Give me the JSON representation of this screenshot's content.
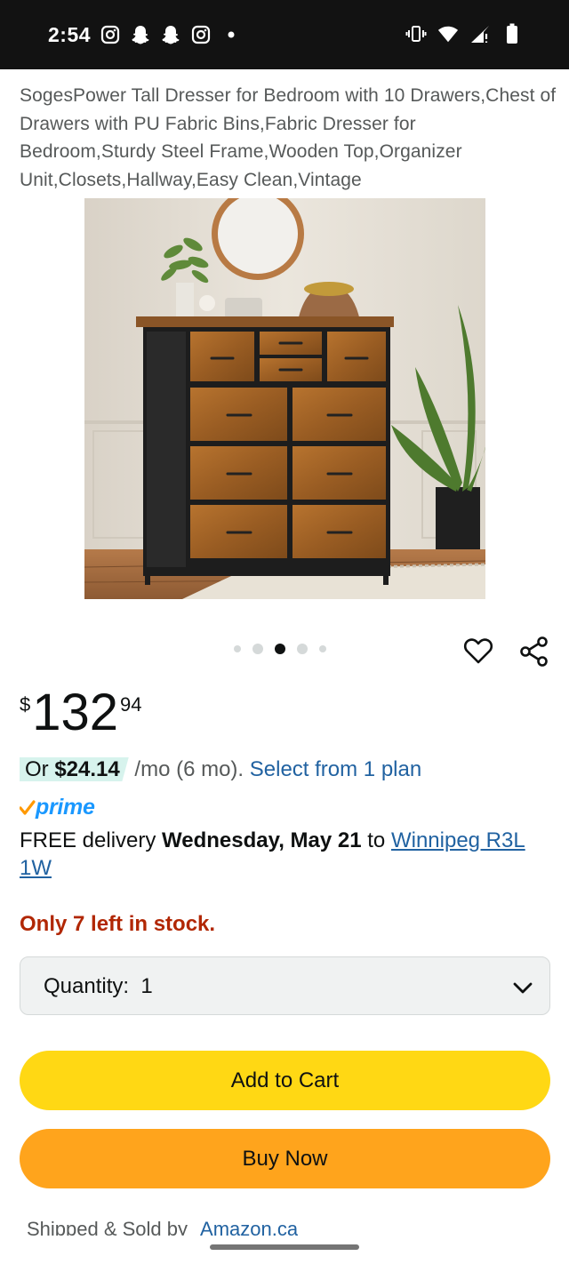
{
  "status_bar": {
    "time": "2:54",
    "left_icons": [
      "instagram-icon",
      "snapchat-icon",
      "snapchat-icon",
      "instagram-icon",
      "dot-icon"
    ],
    "right_icons": [
      "vibrate-icon",
      "wifi-icon",
      "signal-icon",
      "battery-icon"
    ]
  },
  "product": {
    "title": "SogesPower Tall Dresser for Bedroom with 10 Drawers,Chest of Drawers with PU Fabric Bins,Fabric Dresser for Bedroom,Sturdy Steel Frame,Wooden Top,Organizer Unit,Closets,Hallway,Easy Clean,Vintage",
    "image_alt": "Tall dresser with 10 brown fabric drawers",
    "carousel": {
      "count": 5,
      "active_index": 2
    }
  },
  "price": {
    "symbol": "$",
    "whole": "132",
    "fraction": "94"
  },
  "installment": {
    "prefix": "Or ",
    "amount": "$24.14",
    "terms": " /mo (6 mo). ",
    "link": "Select from 1 plan"
  },
  "prime": {
    "label": "prime"
  },
  "delivery": {
    "free": "FREE delivery ",
    "date": "Wednesday, May 21",
    "to": " to ",
    "location": "Winnipeg R3L 1W"
  },
  "stock": {
    "text": "Only 7 left in stock."
  },
  "quantity": {
    "label": "Quantity:",
    "value": "1"
  },
  "buttons": {
    "add_to_cart": "Add to Cart",
    "buy_now": "Buy Now"
  },
  "shipped": {
    "label": "Shipped & Sold by",
    "seller": "Amazon.ca"
  },
  "colors": {
    "add_to_cart": "#ffd814",
    "buy_now": "#ffa41c",
    "link": "#2162a1",
    "stock": "#b12704",
    "prime": "#1a98ff"
  }
}
